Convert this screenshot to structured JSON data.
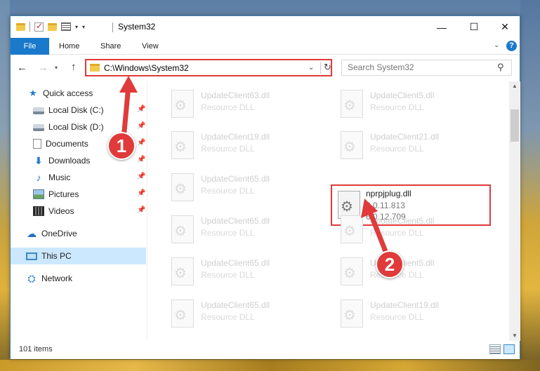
{
  "window": {
    "title": "System32",
    "controls": {
      "minimize": "—",
      "maximize": "☐",
      "close": "✕"
    }
  },
  "ribbon": {
    "tabs": [
      "File",
      "Home",
      "Share",
      "View"
    ],
    "help": "?"
  },
  "address": {
    "path": "C:\\Windows\\System32",
    "search_placeholder": "Search System32"
  },
  "sidebar": {
    "items": [
      {
        "label": "Quick access",
        "icon": "star-icon"
      },
      {
        "label": "Local Disk (C:)",
        "icon": "disk-icon",
        "pinned": true
      },
      {
        "label": "Local Disk (D:)",
        "icon": "disk-icon",
        "pinned": true
      },
      {
        "label": "Documents",
        "icon": "documents-icon",
        "pinned": true
      },
      {
        "label": "Downloads",
        "icon": "download-icon",
        "pinned": true
      },
      {
        "label": "Music",
        "icon": "music-icon",
        "pinned": true
      },
      {
        "label": "Pictures",
        "icon": "pictures-icon",
        "pinned": true
      },
      {
        "label": "Videos",
        "icon": "videos-icon",
        "pinned": true
      },
      {
        "label": "OneDrive",
        "icon": "cloud-icon"
      },
      {
        "label": "This PC",
        "icon": "pc-icon",
        "selected": true
      },
      {
        "label": "Network",
        "icon": "network-icon"
      }
    ]
  },
  "files": {
    "left": [
      {
        "name": "UpdateClient63.dll",
        "desc": "Resource DLL"
      },
      {
        "name": "UpdateClient19.dll",
        "desc": "Resource DLL"
      },
      {
        "name": "UpdateClient65.dll",
        "desc": "Resource DLL"
      },
      {
        "name": "UpdateClient65.dll",
        "desc": "Resource DLL"
      },
      {
        "name": "UpdateClient65.dll",
        "desc": "Resource DLL"
      },
      {
        "name": "UpdateClient65.dll",
        "desc": "Resource DLL"
      }
    ],
    "right": [
      {
        "name": "UpdateClient5.dll",
        "desc": "Resource DLL"
      },
      {
        "name": "UpdateClient21.dll",
        "desc": "Resource DLL"
      },
      {
        "name": "UpdateClient5.dll",
        "desc": "Resource DLL"
      },
      {
        "name": "UpdateClient5.dll",
        "desc": "Resource DLL"
      },
      {
        "name": "UpdateClient19.dll",
        "desc": "Resource DLL"
      }
    ],
    "highlighted": {
      "name": "nprpjplug.dll",
      "version1": "6.0.11.813",
      "version2": "6.0.12.709"
    }
  },
  "status": {
    "count": "101 items"
  },
  "annotations": {
    "step1": "1",
    "step2": "2",
    "color": "#e03a3a"
  }
}
